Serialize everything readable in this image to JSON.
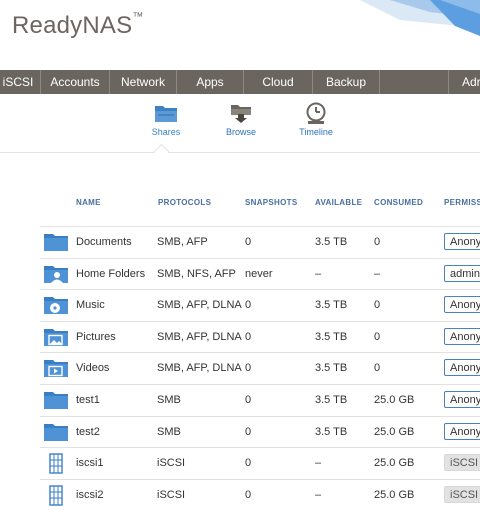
{
  "brand": {
    "name": "ReadyNAS",
    "tm": "™"
  },
  "nav": {
    "items": [
      "iSCSI",
      "Accounts",
      "Network",
      "Apps",
      "Cloud",
      "Backup",
      "",
      "Adr"
    ]
  },
  "subnav": {
    "tabs": [
      "Shares",
      "Browse",
      "Timeline"
    ],
    "active": "Shares"
  },
  "table": {
    "headers": [
      "NAME",
      "PROTOCOLS",
      "SNAPSHOTS",
      "AVAILABLE",
      "CONSUMED",
      "PERMISS"
    ],
    "rows": [
      {
        "icon": "folder-icon",
        "name": "Documents",
        "protocols": "SMB, AFP",
        "snapshots": "0",
        "available": "3.5 TB",
        "consumed": "0",
        "permission": "Anony"
      },
      {
        "icon": "home-folder-icon",
        "name": "Home Folders",
        "protocols": "SMB, NFS, AFP",
        "snapshots": "never",
        "available": "–",
        "consumed": "–",
        "permission": "admin"
      },
      {
        "icon": "music-folder-icon",
        "name": "Music",
        "protocols": "SMB, AFP, DLNA",
        "snapshots": "0",
        "available": "3.5 TB",
        "consumed": "0",
        "permission": "Anony"
      },
      {
        "icon": "pictures-folder-icon",
        "name": "Pictures",
        "protocols": "SMB, AFP, DLNA",
        "snapshots": "0",
        "available": "3.5 TB",
        "consumed": "0",
        "permission": "Anony"
      },
      {
        "icon": "videos-folder-icon",
        "name": "Videos",
        "protocols": "SMB, AFP, DLNA",
        "snapshots": "0",
        "available": "3.5 TB",
        "consumed": "0",
        "permission": "Anony"
      },
      {
        "icon": "folder-icon",
        "name": "test1",
        "protocols": "SMB",
        "snapshots": "0",
        "available": "3.5 TB",
        "consumed": "25.0 GB",
        "permission": "Anony"
      },
      {
        "icon": "folder-icon",
        "name": "test2",
        "protocols": "SMB",
        "snapshots": "0",
        "available": "3.5 TB",
        "consumed": "25.0 GB",
        "permission": "Anony"
      },
      {
        "icon": "iscsi-lun-icon",
        "name": "iscsi1",
        "protocols": "iSCSI",
        "snapshots": "0",
        "available": "–",
        "consumed": "25.0 GB",
        "permission": "iSCSI"
      },
      {
        "icon": "iscsi-lun-icon",
        "name": "iscsi2",
        "protocols": "iSCSI",
        "snapshots": "0",
        "available": "–",
        "consumed": "25.0 GB",
        "permission": "iSCSI"
      }
    ]
  },
  "colors": {
    "nav_bg": "#6b6560",
    "accent": "#3a82c4",
    "folder": "#4a8bd2"
  }
}
